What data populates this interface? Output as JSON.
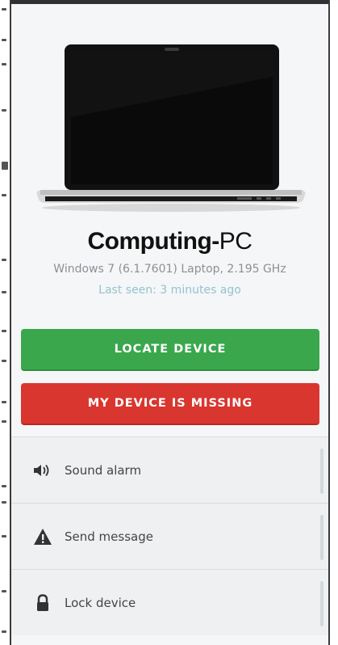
{
  "device": {
    "name_main": "Computing-",
    "name_suffix": "PC",
    "specs": "Windows 7 (6.1.7601) Laptop, 2.195 GHz",
    "last_seen": "Last seen: 3 minutes ago",
    "image": "laptop-image"
  },
  "buttons": {
    "locate_label": "LOCATE DEVICE",
    "missing_label": "MY DEVICE IS MISSING"
  },
  "actions": [
    {
      "label": "Sound alarm",
      "icon": "speaker-icon"
    },
    {
      "label": "Send message",
      "icon": "warning-icon"
    },
    {
      "label": "Lock device",
      "icon": "lock-icon"
    }
  ],
  "colors": {
    "locate": "#3aa74c",
    "missing": "#d9362f",
    "last_seen": "#93c3d1"
  }
}
